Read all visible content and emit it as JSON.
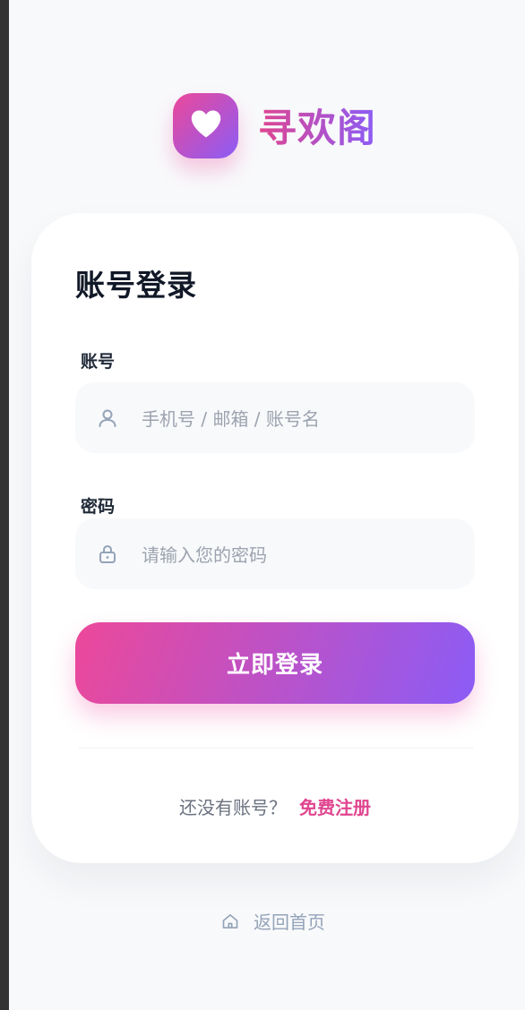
{
  "brand": {
    "name": "寻欢阁",
    "logo_icon": "heart-icon"
  },
  "login": {
    "title": "账号登录",
    "account": {
      "label": "账号",
      "placeholder": "手机号 / 邮箱 / 账号名",
      "icon": "user-icon"
    },
    "password": {
      "label": "密码",
      "placeholder": "请输入您的密码",
      "icon": "lock-icon"
    },
    "submit_label": "立即登录",
    "register_prompt": "还没有账号？",
    "register_link": "免费注册"
  },
  "footer": {
    "home_label": "返回首页",
    "home_icon": "home-icon"
  },
  "colors": {
    "accent_pink": "#ec4899",
    "accent_purple": "#8b5cf6",
    "background": "#f8f9fb"
  }
}
